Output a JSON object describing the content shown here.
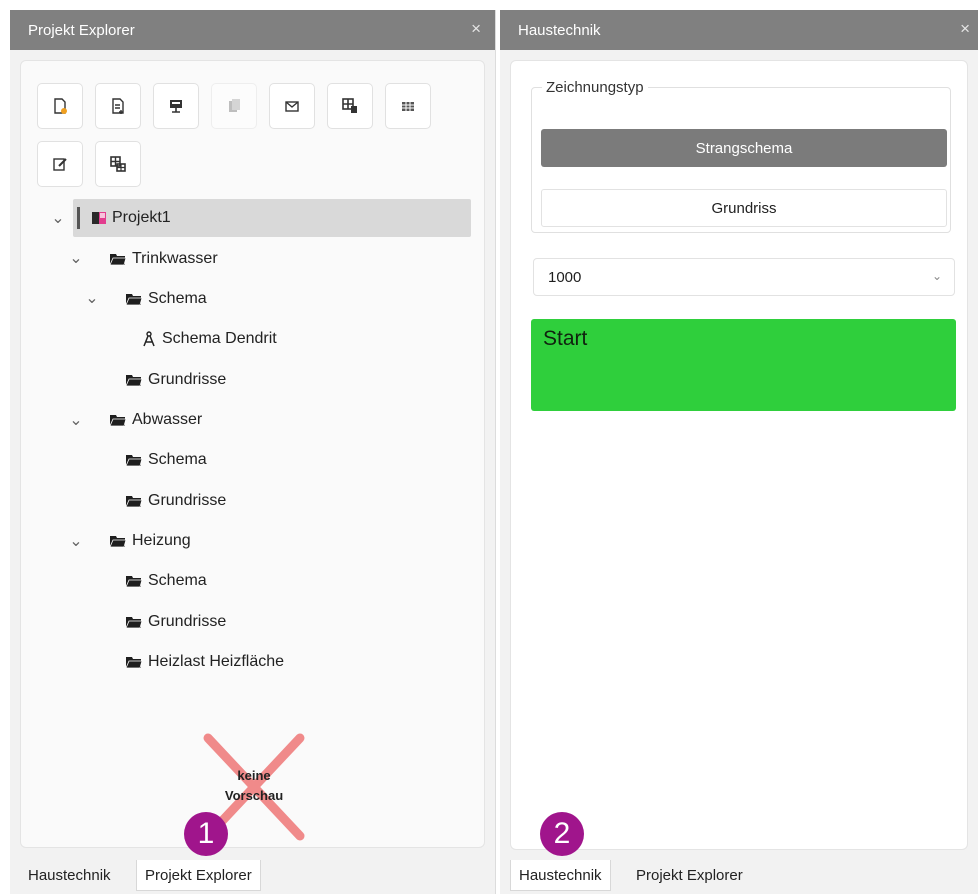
{
  "left_pane": {
    "title": "Projekt Explorer",
    "close_glyph": "×",
    "toolbar": [
      {
        "icon": "new-file-icon",
        "enabled": true
      },
      {
        "icon": "add-document-icon",
        "enabled": true
      },
      {
        "icon": "presentation-icon",
        "enabled": true
      },
      {
        "icon": "copy-icon",
        "enabled": false
      },
      {
        "icon": "mail-icon",
        "enabled": true
      },
      {
        "icon": "table-export-icon",
        "enabled": true
      },
      {
        "icon": "grid-icon",
        "enabled": true
      },
      {
        "icon": "edit-icon",
        "enabled": true
      },
      {
        "icon": "layout-icon",
        "enabled": true
      }
    ],
    "tree": {
      "root": "Projekt1",
      "folders": {
        "trinkwasser": "Trinkwasser",
        "trinkwasser_schema": "Schema",
        "schema_dendrit": "Schema Dendrit",
        "trinkwasser_grundrisse": "Grundrisse",
        "abwasser": "Abwasser",
        "abwasser_schema": "Schema",
        "abwasser_grundrisse": "Grundrisse",
        "heizung": "Heizung",
        "heizung_schema": "Schema",
        "heizung_grundrisse": "Grundrisse",
        "heizlast": "Heizlast Heizfläche"
      }
    },
    "no_preview": {
      "line1": "keine",
      "line2": "Vorschau"
    },
    "tabs": {
      "tab1": "Haustechnik",
      "tab2": "Projekt Explorer",
      "active": "Projekt Explorer"
    },
    "badge": "1"
  },
  "right_pane": {
    "title": "Haustechnik",
    "close_glyph": "×",
    "group_label": "Zeichnungstyp",
    "primary_button": "Strangschema",
    "secondary_button": "Grundriss",
    "scale_select": "1000",
    "start_button": "Start",
    "tabs": {
      "tab1": "Haustechnik",
      "tab2": "Projekt Explorer",
      "active": "Haustechnik"
    },
    "badge": "2"
  },
  "colors": {
    "titlebar": "#808080",
    "primary_button": "#7b7b7b",
    "start_button": "#2fcf3c",
    "badge": "#a0158c",
    "cross": "#f08080"
  }
}
